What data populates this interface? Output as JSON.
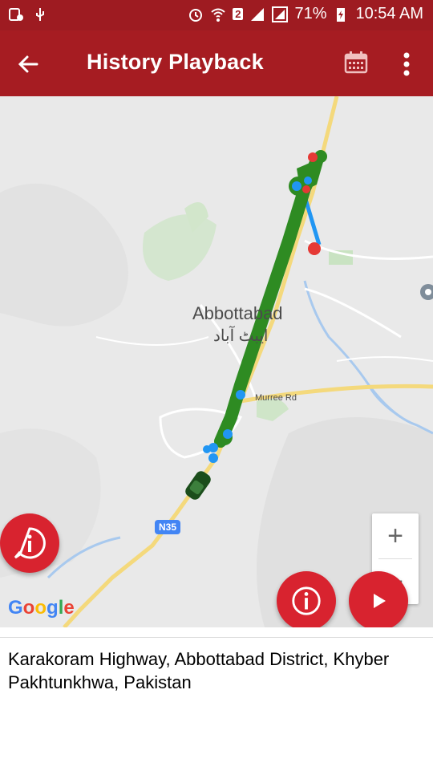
{
  "status_bar": {
    "battery": "71%",
    "time": "10:54 AM",
    "sim_badge": "2"
  },
  "toolbar": {
    "title": "History Playback",
    "back_icon": "arrow-back-icon",
    "calendar_icon": "calendar-icon",
    "more_icon": "more-vert-icon"
  },
  "map": {
    "city_label": "Abbottabad",
    "city_label_urdu": "ایبٹ آباد",
    "road_label": "Murree Rd",
    "highway_shield": "N35",
    "zoom_in": "+",
    "zoom_out": "−",
    "attribution": "Google"
  },
  "colors": {
    "primary": "#a61c22",
    "fab": "#d8232f",
    "track": "#2e8b22",
    "track_alt": "#1e88e5",
    "marker_stop": "#e53935"
  },
  "address": {
    "text": "Karakoram Highway, Abbottabad District, Khyber Pakhtunkhwa, Pakistan"
  }
}
